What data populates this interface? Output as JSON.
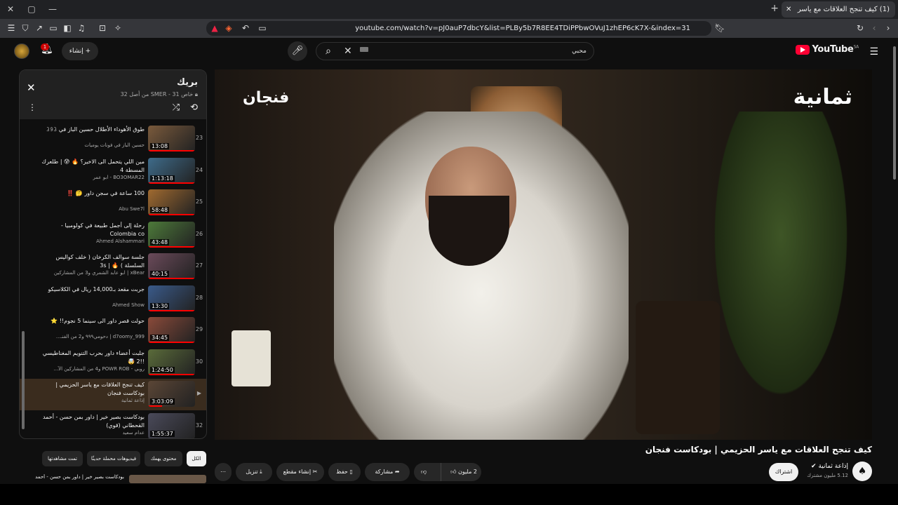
{
  "browser": {
    "tab_title": "(1) كيف تنجح العلاقات مع ياسر",
    "url": "youtube.com/watch?v=pJ0auP7dbcY&list=PLBy5b7R8EE4TDiPPbwOVuJ1zhEP6cK7X-&index=31",
    "close_symbol": "✕",
    "new_tab_symbol": "+",
    "window_close_symbol": "✕",
    "window_max_symbol": "▢",
    "window_min_symbol": "—"
  },
  "header": {
    "search_value": "محبي",
    "create_label": "إنشاء",
    "notification_count": "1",
    "logo_text": "YouTube",
    "logo_region": "SA"
  },
  "video": {
    "brand_left": "فنجان",
    "brand_right": "ثمانية",
    "title": "كيف تنجح العلاقات مع ياسر الحزيمي | بودكاست فنجان",
    "channel_name": "إذاعة ثمانية",
    "subscribers": "5.12 مليون مشترك",
    "subscribe_label": "اشتراك",
    "likes_label": "2 مليون",
    "share_label": "مشاركة",
    "save_label": "حفظ",
    "clip_label": "إنشاء مقطع",
    "download_label": "تنزيل"
  },
  "playlist": {
    "title": "بريك",
    "subtitle": "خاص SMER - 31 من أصل 32",
    "items": [
      {
        "index": "23",
        "title": "طوق الأهوداء الأطلال حسين الباز في 𝟹𝟿𝟹",
        "channel": "حسين الباز في فونات يوميات",
        "duration": "13:08",
        "progress": 1.0
      },
      {
        "index": "24",
        "title": "مين اللي يتحمل الى الاخير؟ 🔥 😰 | طلعرك المسطة 4",
        "channel": "BO3OMAR22 - ابو عمر",
        "duration": "1:13:18",
        "progress": 1.0
      },
      {
        "index": "25",
        "title": "100 ساعة في سجن داور 🤔 ‼️",
        "channel": "Abu Swe7l",
        "duration": "58:48",
        "progress": 1.0
      },
      {
        "index": "26",
        "title": "رحلة إلى أجمل طبيعة في كولومبيا - Colombia co",
        "channel": "Ahmed Alshammari",
        "duration": "43:48",
        "progress": 1.0
      },
      {
        "index": "27",
        "title": "جلسة سوالف الكرخان ( خلف كواليس السلسلة ) 🔥 | 3s",
        "channel": "xBear | ابو عابد الشمري و3 من المشاركين",
        "duration": "40:15",
        "progress": 1.0
      },
      {
        "index": "28",
        "title": "جربت مقعد بـ14,000 ريال في الكلاسيكو",
        "channel": "Ahmed Show",
        "duration": "13:30",
        "progress": 1.0
      },
      {
        "index": "29",
        "title": "حولت قصر داور الى سينما 5 نجوم!! ⭐",
        "channel": "d7oomy_999 | دحومي٩٩٩ و2 من الفنـ...",
        "duration": "34:45",
        "progress": 1.0
      },
      {
        "index": "30",
        "title": "جلبت أعضاء داور بحرب التنويم المغناطيسي !!2 🤯",
        "channel": "روبي - POWR ROB و4 من المشاركين الآ...",
        "duration": "1:24:50",
        "progress": 1.0
      },
      {
        "index": "",
        "title": "كيف تنجح العلاقات مع ياسر الحزيمي | بودكاست فنجان",
        "channel": "إذاعة ثمانية",
        "duration": "3:03:09",
        "progress": 0.3
      },
      {
        "index": "32",
        "title": "بودكاست بصير خير | داور بمن حسن - أحمد القحطاني (قوي)",
        "channel": "عدام سعيد",
        "duration": "1:55:37",
        "progress": 0.0
      }
    ],
    "now_playing_symbol": "▶"
  },
  "chips": [
    "الكل",
    "محتوى يهمك",
    "فيديوهات محملة حديثًا",
    "تمت مشاهدتها"
  ],
  "next_row": "بودكاست بصير خير | داور بمن حسن - أحمد",
  "colors": {
    "accent": "#ff0000",
    "brand": "#ff0033",
    "active_item": "#3a2c1e"
  }
}
